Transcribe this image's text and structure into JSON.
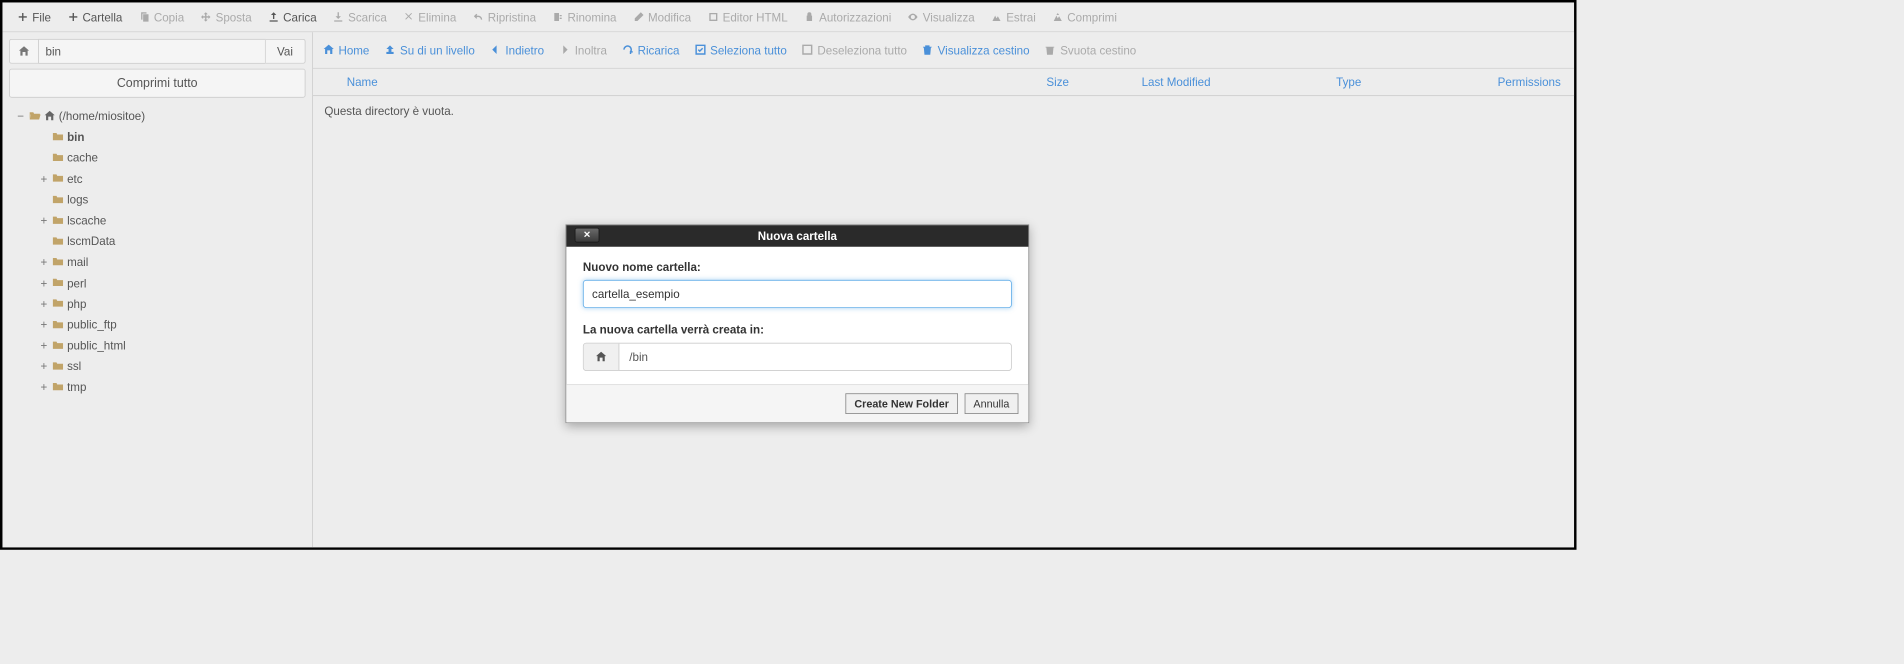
{
  "toolbar": [
    {
      "icon": "plus",
      "label": "File",
      "disabled": false
    },
    {
      "icon": "plus",
      "label": "Cartella",
      "disabled": false
    },
    {
      "icon": "copy",
      "label": "Copia",
      "disabled": true
    },
    {
      "icon": "move",
      "label": "Sposta",
      "disabled": true
    },
    {
      "icon": "upload",
      "label": "Carica",
      "disabled": false
    },
    {
      "icon": "download",
      "label": "Scarica",
      "disabled": true
    },
    {
      "icon": "delete",
      "label": "Elimina",
      "disabled": true
    },
    {
      "icon": "undo",
      "label": "Ripristina",
      "disabled": true
    },
    {
      "icon": "rename",
      "label": "Rinomina",
      "disabled": true
    },
    {
      "icon": "edit",
      "label": "Modifica",
      "disabled": true
    },
    {
      "icon": "html",
      "label": "Editor HTML",
      "disabled": true
    },
    {
      "icon": "perm",
      "label": "Autorizzazioni",
      "disabled": true
    },
    {
      "icon": "view",
      "label": "Visualizza",
      "disabled": true
    },
    {
      "icon": "extract",
      "label": "Estrai",
      "disabled": true
    },
    {
      "icon": "compress",
      "label": "Comprimi",
      "disabled": true
    }
  ],
  "path_input": "bin",
  "path_go": "Vai",
  "compress_all": "Comprimi tutto",
  "tree": {
    "root_label": "(/home/miositoe)",
    "items": [
      {
        "label": "bin",
        "bold": true,
        "expandable": false
      },
      {
        "label": "cache",
        "expandable": false
      },
      {
        "label": "etc",
        "expandable": true
      },
      {
        "label": "logs",
        "expandable": false
      },
      {
        "label": "lscache",
        "expandable": true
      },
      {
        "label": "lscmData",
        "expandable": false
      },
      {
        "label": "mail",
        "expandable": true
      },
      {
        "label": "perl",
        "expandable": true
      },
      {
        "label": "php",
        "expandable": true
      },
      {
        "label": "public_ftp",
        "expandable": true
      },
      {
        "label": "public_html",
        "expandable": true
      },
      {
        "label": "ssl",
        "expandable": true
      },
      {
        "label": "tmp",
        "expandable": true
      }
    ]
  },
  "subnav": [
    {
      "icon": "home",
      "label": "Home",
      "disabled": false
    },
    {
      "icon": "up",
      "label": "Su di un livello",
      "disabled": false
    },
    {
      "icon": "back",
      "label": "Indietro",
      "disabled": false
    },
    {
      "icon": "fwd",
      "label": "Inoltra",
      "disabled": true
    },
    {
      "icon": "reload",
      "label": "Ricarica",
      "disabled": false
    },
    {
      "icon": "select",
      "label": "Seleziona tutto",
      "disabled": false
    },
    {
      "icon": "deselect",
      "label": "Deseleziona tutto",
      "disabled": true
    },
    {
      "icon": "trash",
      "label": "Visualizza cestino",
      "disabled": false
    },
    {
      "icon": "empty",
      "label": "Svuota cestino",
      "disabled": true
    }
  ],
  "columns": {
    "name": "Name",
    "size": "Size",
    "modified": "Last Modified",
    "type": "Type",
    "permissions": "Permissions"
  },
  "empty_msg": "Questa directory è vuota.",
  "modal": {
    "title": "Nuova cartella",
    "name_label": "Nuovo nome cartella:",
    "name_value": "cartella_esempio",
    "path_label": "La nuova cartella verrà creata in:",
    "path_value": "/bin",
    "create_btn": "Create New Folder",
    "cancel_btn": "Annulla"
  }
}
